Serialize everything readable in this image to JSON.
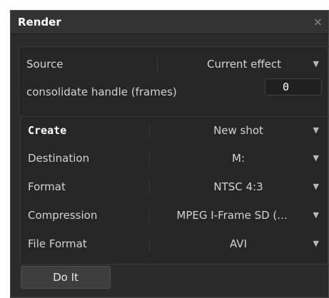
{
  "window": {
    "title": "Render",
    "close_glyph": "×"
  },
  "source": {
    "label": "Source",
    "value": "Current effect"
  },
  "consolidate": {
    "label": "consolidate handle (frames)",
    "value": "0"
  },
  "create": {
    "label": "Create",
    "value": "New shot"
  },
  "destination": {
    "label": "Destination",
    "value": "M:"
  },
  "format": {
    "label": "Format",
    "value": "NTSC 4:3"
  },
  "compression": {
    "label": "Compression",
    "value": "MPEG I-Frame SD (..."
  },
  "file_format": {
    "label": "File Format",
    "value": "AVI"
  },
  "actions": {
    "do_it": "Do It"
  },
  "icons": {
    "dropdown": "chevron-down-icon",
    "close": "close-icon"
  },
  "colors": {
    "background": "#2b2b2b",
    "panel": "#262626",
    "text": "#d4d4d4"
  }
}
